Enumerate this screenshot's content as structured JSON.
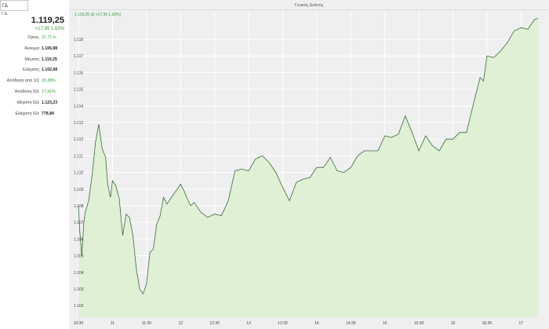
{
  "left": {
    "search_value": "ΓΔ",
    "sub_label": "Γ.Δ.",
    "price": "1.119,25",
    "change": "+17,95  1,63%",
    "stats": [
      {
        "label": "Όγκος",
        "value": "37,71 m",
        "green": true
      },
      {
        "label": "Άνοιγμα",
        "value": "1.106,98",
        "green": false
      },
      {
        "label": "Μέγιστη",
        "value": "1.119,25",
        "green": false
      },
      {
        "label": "Ελάχιστη",
        "value": "1.102,68",
        "green": false
      },
      {
        "label": "Απόδοση από 1/1",
        "value": "20,38%",
        "green": true
      },
      {
        "label": "Απόδοση 52ε",
        "value": "17,91%",
        "green": true
      },
      {
        "label": "Μέγιστη 52ε",
        "value": "1.123,23",
        "green": false
      },
      {
        "label": "Ελάχιστη 52ε",
        "value": "778,84",
        "green": false
      }
    ]
  },
  "chart": {
    "title": "Γενικός Δείκτης",
    "header_value": "1.119,25 (Δ +17,95 1,63%)",
    "colors": {
      "line": "#3a6a3a",
      "fill": "#dff0d4",
      "bg": "#efefef",
      "grid": "#ffffff",
      "header": "#3a9a3a"
    }
  },
  "chart_data": {
    "type": "area",
    "title": "Γενικός Δείκτης",
    "xlabel": "",
    "ylabel": "",
    "ylim": [
      1101.3,
      1119.7
    ],
    "y_ticks": [
      1102,
      1103,
      1104,
      1105,
      1106,
      1107,
      1108,
      1109,
      1110,
      1111,
      1112,
      1113,
      1114,
      1115,
      1116,
      1117,
      1118
    ],
    "y_tick_labels": [
      "1.102",
      "1.103",
      "1.104",
      "1.105",
      "1.106",
      "1.107",
      "1.108",
      "1.109",
      "1.110",
      "1.111",
      "1.112",
      "1.113",
      "1.114",
      "1.115",
      "1.116",
      "1.117",
      "1.118"
    ],
    "x_range": [
      10.5,
      17.25
    ],
    "x_ticks": [
      10.5,
      11,
      11.5,
      12,
      12.5,
      13,
      13.5,
      14,
      14.5,
      15,
      15.5,
      16,
      16.5,
      17
    ],
    "x_tick_labels": [
      "10:30",
      "11",
      "11:30",
      "12",
      "12:30",
      "13",
      "13:30",
      "14",
      "14:30",
      "15",
      "15:30",
      "16",
      "16:30",
      "17"
    ],
    "grid": true,
    "series": [
      {
        "x": [
          10.5,
          10.52,
          10.55,
          10.58,
          10.6,
          10.65,
          10.7,
          10.75,
          10.8,
          10.85,
          10.9,
          10.93,
          10.97,
          11,
          11.05,
          11.1,
          11.15,
          11.2,
          11.25,
          11.3,
          11.35,
          11.4,
          11.45,
          11.5,
          11.55,
          11.6,
          11.65,
          11.7,
          11.75,
          11.8,
          11.85,
          11.9,
          11.95,
          12,
          12.05,
          12.1,
          12.15,
          12.2,
          12.3,
          12.4,
          12.5,
          12.6,
          12.7,
          12.8,
          12.9,
          13,
          13.1,
          13.2,
          13.3,
          13.4,
          13.5,
          13.6,
          13.7,
          13.8,
          13.9,
          14,
          14.1,
          14.2,
          14.3,
          14.4,
          14.5,
          14.6,
          14.7,
          14.8,
          14.9,
          15,
          15.1,
          15.2,
          15.3,
          15.4,
          15.5,
          15.6,
          15.7,
          15.8,
          15.9,
          16,
          16.1,
          16.2,
          16.3,
          16.4,
          16.45,
          16.5,
          16.6,
          16.7,
          16.8,
          16.9,
          17,
          17.1,
          17.2,
          17.25
        ],
        "y": [
          1108.0,
          1106.5,
          1105.0,
          1107.0,
          1107.6,
          1108.3,
          1109.8,
          1111.8,
          1112.9,
          1111.4,
          1110.9,
          1109.3,
          1108.5,
          1109.5,
          1109.2,
          1108.4,
          1106.2,
          1107.5,
          1107.3,
          1106.2,
          1104.2,
          1103.0,
          1102.7,
          1103.3,
          1105.2,
          1105.4,
          1106.9,
          1107.4,
          1108.5,
          1108.1,
          1108.4,
          1108.7,
          1109.0,
          1109.3,
          1108.9,
          1108.4,
          1108.0,
          1108.2,
          1107.6,
          1107.3,
          1107.5,
          1107.4,
          1108.3,
          1110.1,
          1110.2,
          1110.1,
          1110.8,
          1111.0,
          1110.6,
          1110.0,
          1109.1,
          1108.3,
          1109.4,
          1109.6,
          1109.7,
          1110.3,
          1110.3,
          1110.9,
          1110.1,
          1110.0,
          1110.3,
          1111.0,
          1111.3,
          1111.3,
          1111.3,
          1112.2,
          1112.1,
          1112.3,
          1113.4,
          1112.4,
          1111.3,
          1112.2,
          1111.6,
          1111.3,
          1112.0,
          1112.0,
          1112.4,
          1112.4,
          1114.1,
          1115.7,
          1115.5,
          1117.0,
          1116.9,
          1117.3,
          1117.8,
          1118.5,
          1118.7,
          1118.6,
          1119.2,
          1119.25
        ]
      }
    ]
  }
}
